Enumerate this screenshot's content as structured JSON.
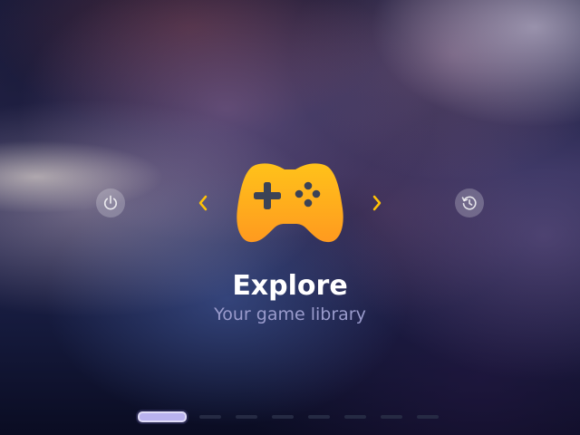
{
  "menu": {
    "title": "Explore",
    "subtitle": "Your game library",
    "icon": "gamepad-icon"
  },
  "left_button": {
    "icon": "power-icon"
  },
  "right_button": {
    "icon": "history-icon"
  },
  "nav": {
    "prev_icon": "chevron-left-icon",
    "next_icon": "chevron-right-icon"
  },
  "pager": {
    "total_pages": 8,
    "active_index": 0
  },
  "colors": {
    "accent_top": "#ffc21a",
    "accent_bottom": "#ff9a1f",
    "arrow": "#ffc107",
    "subtitle": "#9a9bcc",
    "active_page": "#b9b2ee"
  }
}
